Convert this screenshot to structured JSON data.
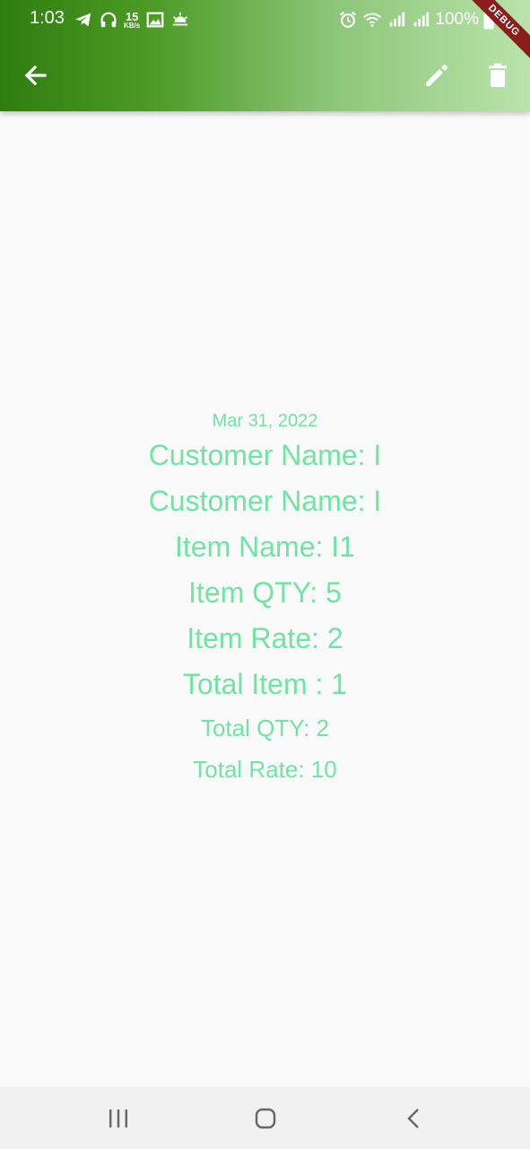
{
  "status_bar": {
    "time": "1:03",
    "net_speed_value": "15",
    "net_speed_unit": "KB/s",
    "battery": "100%"
  },
  "debug_banner": "DEBUG",
  "detail": {
    "date": "Mar 31, 2022",
    "lines": [
      "Customer Name: I",
      "Customer Name: I",
      "Item Name: I1",
      "Item QTY: 5",
      "Item Rate: 2",
      "Total Item : 1",
      "Total QTY: 2",
      "Total Rate: 10"
    ]
  },
  "colors": {
    "appbar_gradient_start": "#2e7d0f",
    "appbar_gradient_end": "#b9e3ab",
    "text_accent": "#6ee6a2",
    "background": "#fafafa"
  },
  "icons": {
    "appbar": [
      "arrow-back-icon",
      "edit-pencil-icon",
      "delete-trash-icon"
    ],
    "navbar": [
      "recents-icon",
      "home-icon",
      "back-chevron-icon"
    ]
  }
}
